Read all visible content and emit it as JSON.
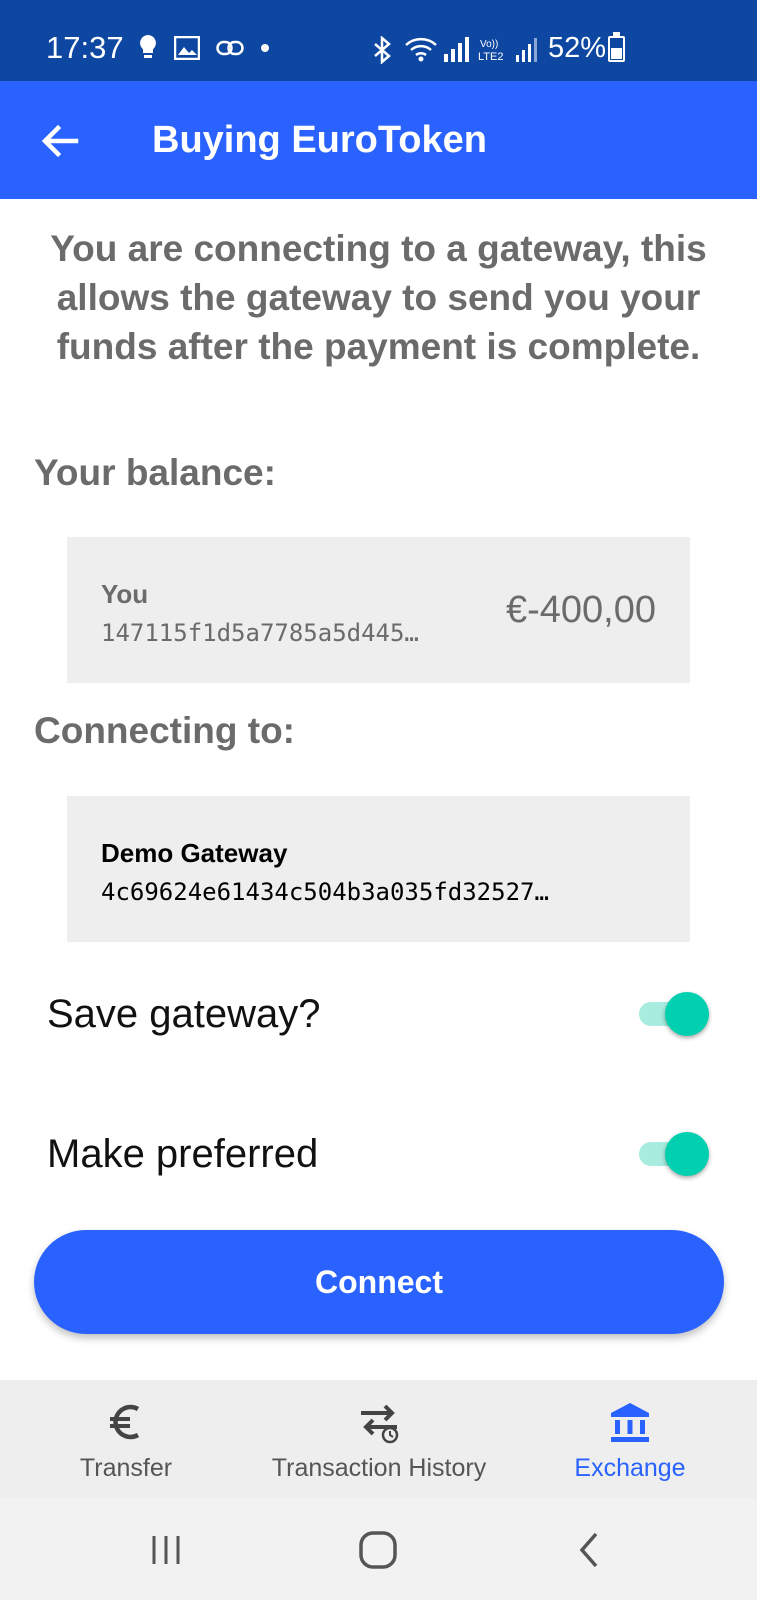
{
  "status_bar": {
    "time": "17:37",
    "battery": "52%"
  },
  "app_bar": {
    "title": "Buying EuroToken",
    "back_icon": "arrow-back-icon"
  },
  "intro_text": "You are connecting to a gateway, this allows the gateway to send you your funds after the payment is complete.",
  "balance_section": {
    "label": "Your balance:",
    "name": "You",
    "public_key": "147115f1d5a7785a5d445…",
    "amount": "€-400,00"
  },
  "gateway_section": {
    "label": "Connecting to:",
    "name": "Demo Gateway",
    "public_key": "4c69624e61434c504b3a035fd32527…"
  },
  "toggles": {
    "save_gateway": {
      "label": "Save gateway?",
      "on": true
    },
    "make_preferred": {
      "label": "Make preferred",
      "on": true
    }
  },
  "connect_button": "Connect",
  "bottom_nav": {
    "items": [
      {
        "label": "Transfer",
        "icon": "euro-icon",
        "active": false
      },
      {
        "label": "Transaction History",
        "icon": "transaction-history-icon",
        "active": false
      },
      {
        "label": "Exchange",
        "icon": "bank-icon",
        "active": true
      }
    ]
  },
  "colors": {
    "status_bar": "#0d47a1",
    "primary": "#2962ff",
    "toggle_accent": "#00d0b0",
    "card_bg": "#eeeeee"
  }
}
